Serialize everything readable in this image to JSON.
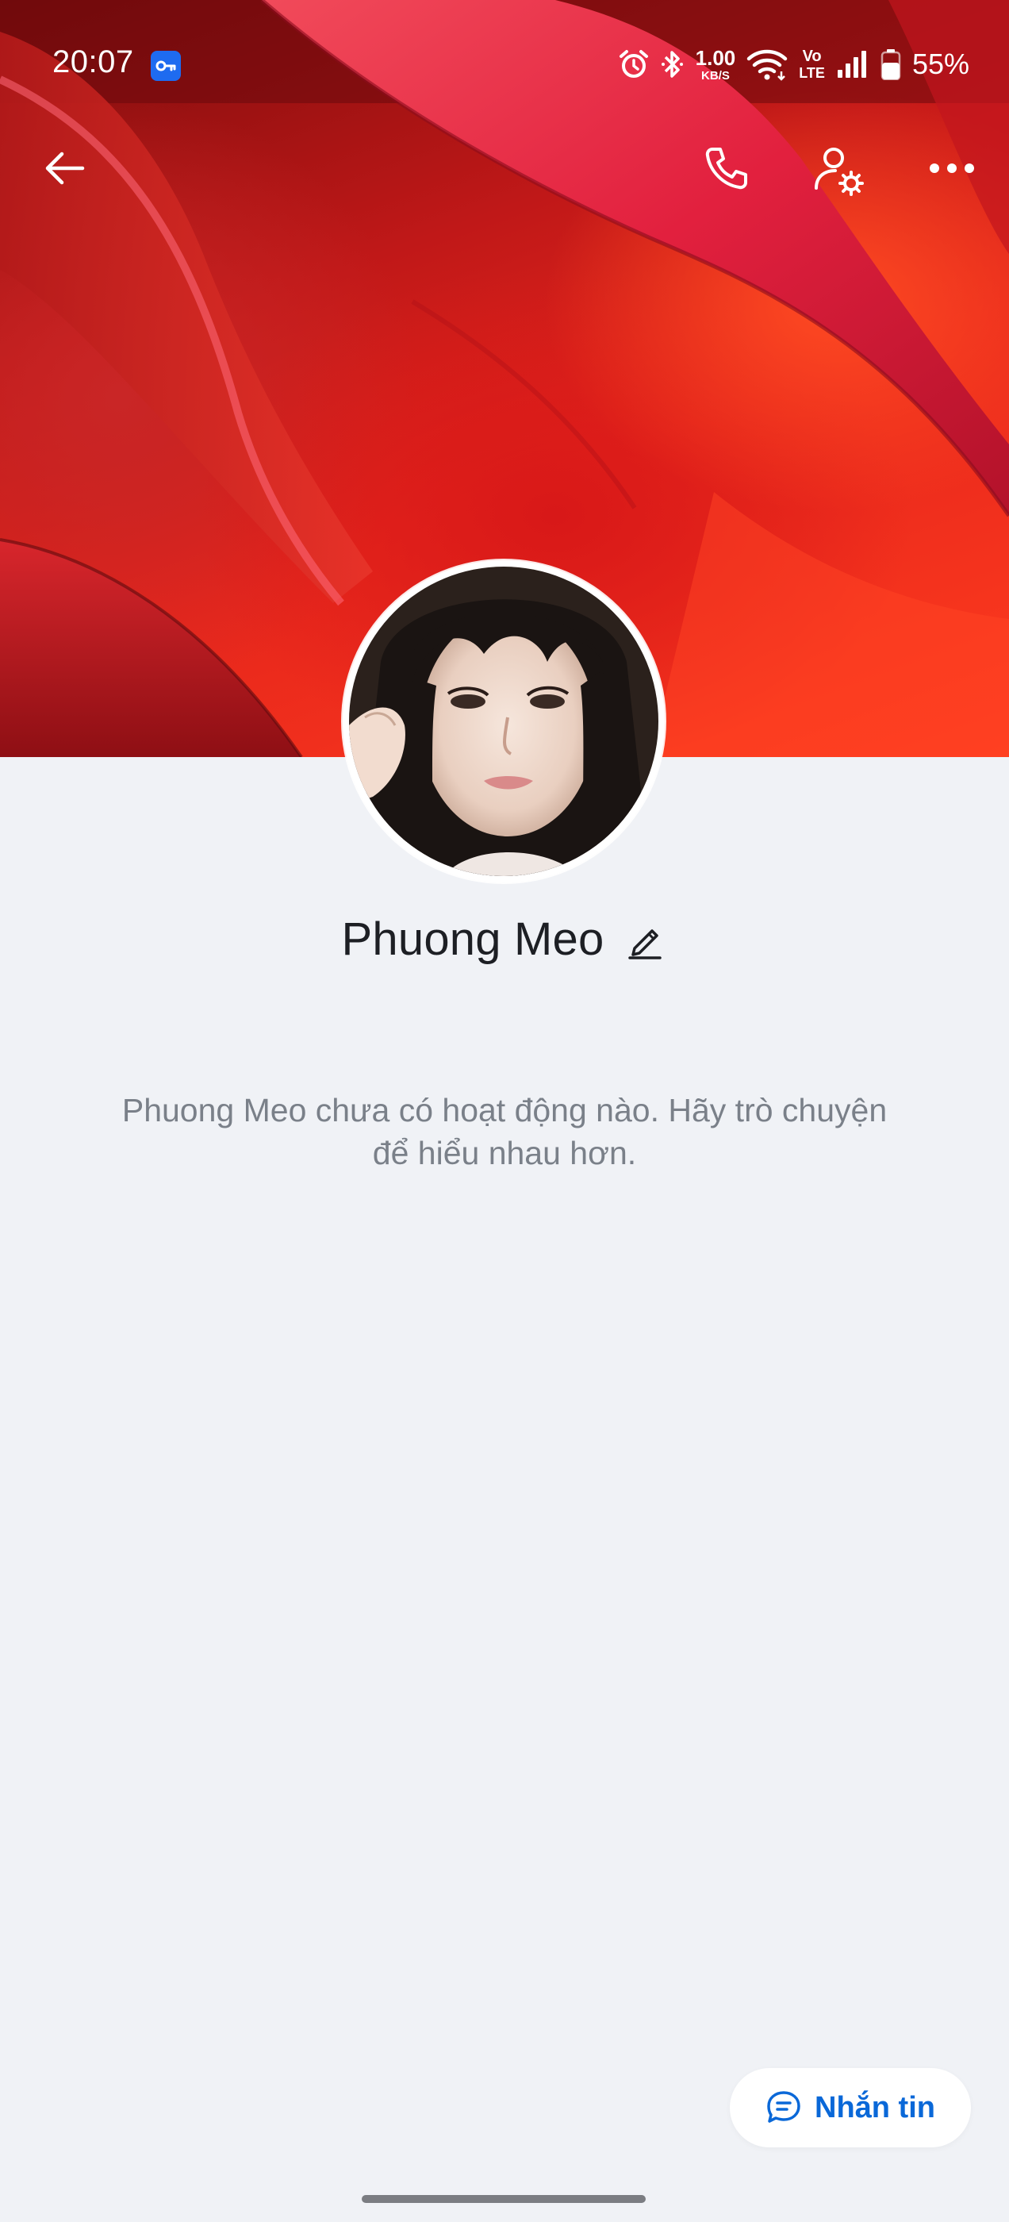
{
  "status_bar": {
    "time": "20:07",
    "net_speed_value": "1.00",
    "net_speed_unit": "KB/S",
    "volte_top": "Vo",
    "volte_bottom": "LTE",
    "battery_percent": "55%",
    "icons": [
      "vpn-key-icon",
      "alarm-icon",
      "bluetooth-icon",
      "wifi-icon",
      "signal-icon",
      "battery-icon"
    ]
  },
  "toolbar": {
    "icons": [
      "back-arrow-icon",
      "phone-icon",
      "user-settings-icon",
      "more-horizontal-icon"
    ]
  },
  "profile": {
    "name": "Phuong Meo",
    "edit_icon": "pencil-icon"
  },
  "activity": {
    "empty_message": "Phuong Meo chưa có hoạt động nào. Hãy trò chuyện để hiểu nhau hơn."
  },
  "actions": {
    "message_label": "Nhắn tin",
    "message_icon": "chat-bubble-icon"
  },
  "colors": {
    "accent": "#0a68d8",
    "background": "#f0f2f6",
    "text_primary": "#1d1f24",
    "text_secondary": "#7a8089"
  }
}
